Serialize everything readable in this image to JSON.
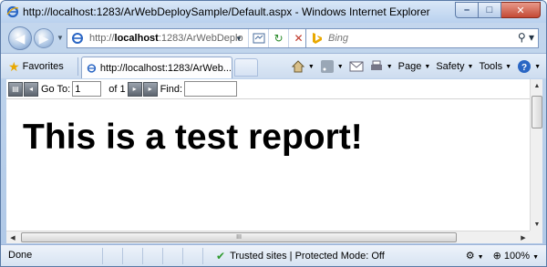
{
  "window": {
    "title": "http://localhost:1283/ArWebDeploySample/Default.aspx - Windows Internet Explorer",
    "minimize_glyph": "–",
    "maximize_glyph": "□",
    "close_glyph": "✕"
  },
  "address_bar": {
    "url_prefix": "http://",
    "url_host": "localhost",
    "url_rest": ":1283/ArWebDeplo",
    "search_placeholder": "Bing"
  },
  "favorites_bar": {
    "favorites_label": "Favorites",
    "tab_title": "http://localhost:1283/ArWeb...",
    "commands": {
      "page_label": "Page",
      "safety_label": "Safety",
      "tools_label": "Tools"
    }
  },
  "report_toolbar": {
    "goto_label": "Go To:",
    "page_value": "1",
    "of_label": "of 1",
    "find_label": "Find:",
    "find_value": ""
  },
  "report": {
    "title": "This is a test report!"
  },
  "scrollbar": {
    "grip_glyph": "III"
  },
  "status_bar": {
    "status_text": "Done",
    "zone_text": "Trusted sites | Protected Mode: Off",
    "zoom_text": "100%"
  },
  "icons": {
    "ie_logo": "ie-logo-icon",
    "favorites": "star-icon",
    "home": "home-icon",
    "feeds": "rss-icon",
    "mail": "mail-icon",
    "print": "printer-icon",
    "help": "help-icon",
    "trusted": "checkmark-icon",
    "zoom": "magnifier-icon"
  },
  "colors": {
    "ie_blue": "#2a66c4",
    "close_red": "#c44a35",
    "trusted_green": "#2f9a2f",
    "star_gold": "#e9a800"
  }
}
